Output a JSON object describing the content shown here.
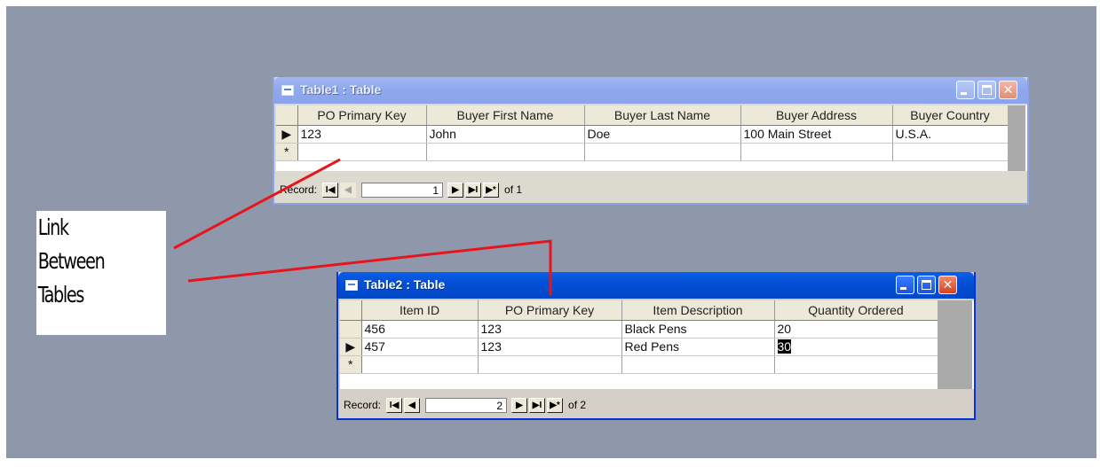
{
  "annotation": {
    "lines": [
      "Link",
      "Between",
      "Tables"
    ]
  },
  "table1": {
    "title": "Table1 : Table",
    "columns": [
      "PO Primary Key",
      "Buyer First Name",
      "Buyer Last Name",
      "Buyer Address",
      "Buyer Country"
    ],
    "rows": [
      {
        "selector": "▶",
        "cells": [
          "123",
          "John",
          "Doe",
          "100 Main Street",
          "U.S.A."
        ]
      },
      {
        "selector": "*",
        "cells": [
          "",
          "",
          "",
          "",
          ""
        ]
      }
    ],
    "record_label": "Record:",
    "record_current": "1",
    "record_of": "of 1"
  },
  "table2": {
    "title": "Table2 : Table",
    "columns": [
      "Item ID",
      "PO Primary Key",
      "Item Description",
      "Quantity Ordered"
    ],
    "rows": [
      {
        "selector": "",
        "cells": [
          "456",
          "123",
          "Black Pens",
          "20"
        ]
      },
      {
        "selector": "▶",
        "cells": [
          "457",
          "123",
          "Red Pens",
          "30"
        ]
      },
      {
        "selector": "*",
        "cells": [
          "",
          "",
          "",
          ""
        ]
      }
    ],
    "record_label": "Record:",
    "record_current": "2",
    "record_of": "of 2"
  },
  "nav_buttons": {
    "first": "I◀",
    "prev": "◀",
    "next": "▶",
    "last": "▶I",
    "new": "▶*"
  },
  "colors": {
    "desktop": "#8f97aa",
    "link_line": "#e8141c",
    "titlebar_active": "#0350d5",
    "titlebar_inactive": "#8ea8ee"
  }
}
